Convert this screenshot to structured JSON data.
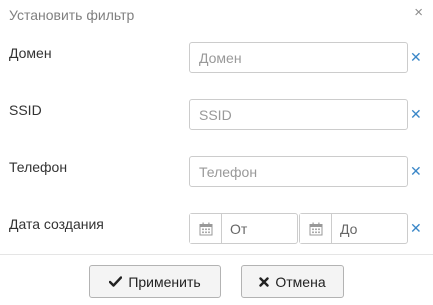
{
  "dialog": {
    "title": "Установить фильтр",
    "close_icon": "close-icon"
  },
  "fields": {
    "domain": {
      "label": "Домен",
      "placeholder": "Домен",
      "value": ""
    },
    "ssid": {
      "label": "SSID",
      "placeholder": "SSID",
      "value": ""
    },
    "phone": {
      "label": "Телефон",
      "placeholder": "Телефон",
      "value": ""
    },
    "created": {
      "label": "Дата создания",
      "from_placeholder": "От",
      "to_placeholder": "До",
      "icon": "calendar-icon"
    }
  },
  "clear_icon": "clear-x-icon",
  "colors": {
    "accent": "#3a87c8",
    "label": "#333333",
    "title": "#808080",
    "border": "#cccccc"
  },
  "buttons": {
    "apply": {
      "label": "Применить",
      "icon": "check-icon"
    },
    "cancel": {
      "label": "Отмена",
      "icon": "times-icon"
    }
  }
}
